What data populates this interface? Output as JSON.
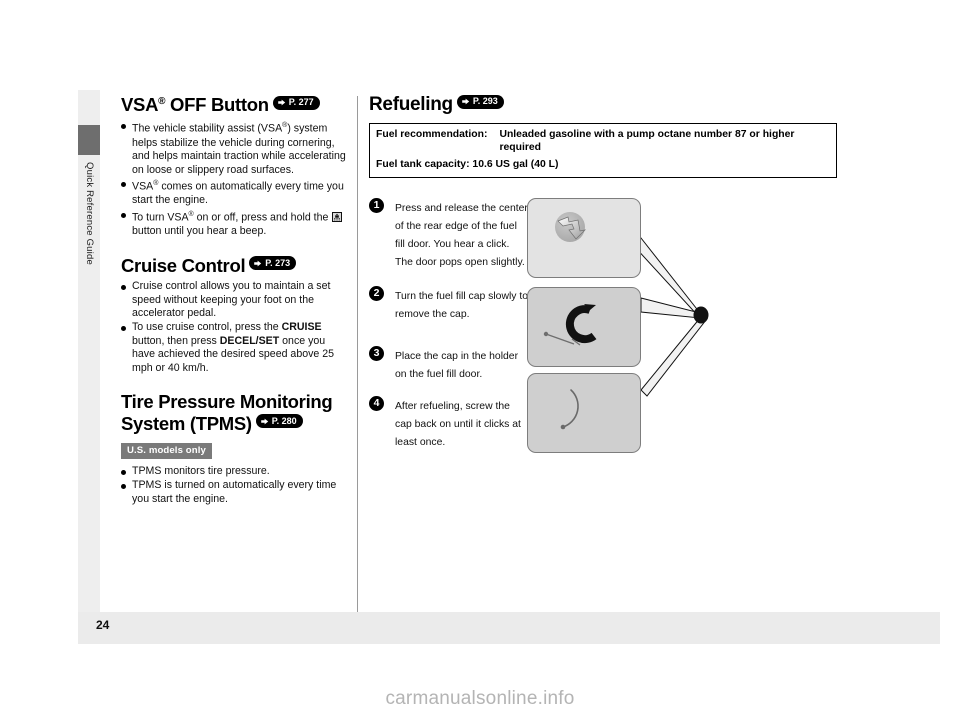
{
  "sidebar": {
    "tab_label": "Quick Reference Guide"
  },
  "left_column": {
    "vsa": {
      "title": "VSA",
      "title_sup": "®",
      "title_rest": " OFF Button",
      "page_ref": "P. 277",
      "bullets": [
        "The vehicle stability assist (VSA®) system helps stabilize the vehicle during cornering, and helps maintain traction while accelerating on loose or slippery road surfaces.",
        "VSA® comes on automatically every time you start the engine.",
        "To turn VSA® on or off, press and hold the [vsa-button-icon] button until you hear a beep."
      ]
    },
    "cruise": {
      "title": "Cruise Control",
      "page_ref": "P. 273",
      "bullets": [
        "Cruise control allows you to maintain a set speed without keeping your foot on the accelerator pedal.",
        "To use cruise control, press the CRUISE button, then press DECEL/SET once you have achieved the desired speed above 25 mph or 40 km/h."
      ],
      "bold_terms": [
        "CRUISE",
        "DECEL/SET"
      ]
    },
    "tpms": {
      "title_line1": "Tire Pressure Monitoring",
      "title_line2": "System (TPMS)",
      "page_ref": "P. 280",
      "badge": "U.S. models only",
      "bullets": [
        "TPMS monitors tire pressure.",
        "TPMS is turned on automatically every time you start the engine."
      ]
    }
  },
  "right_column": {
    "title": "Refueling",
    "page_ref": "P. 293",
    "fuel_table": {
      "rows": [
        {
          "label": "Fuel recommendation:",
          "value": "Unleaded gasoline with a pump octane number 87 or higher required"
        },
        {
          "label": "Fuel tank capacity: 10.6 US gal (40 L)",
          "value": ""
        }
      ]
    },
    "steps": [
      {
        "number": "1",
        "text": "Press and release the center of the rear edge of the fuel fill door. You hear a click. The door pops open slightly."
      },
      {
        "number": "2",
        "text": "Turn the fuel fill cap slowly to remove the cap."
      },
      {
        "number": "3",
        "text": "Place the cap in the holder on the fuel fill door."
      },
      {
        "number": "4",
        "text": "After refueling, screw the cap back on until it clicks at least once."
      }
    ],
    "illustrations": [
      {
        "name": "fuel-fill-door-press-illustration"
      },
      {
        "name": "fuel-cap-turn-illustration"
      },
      {
        "name": "fuel-cap-holder-illustration"
      }
    ]
  },
  "footer": {
    "page_number": "24",
    "watermark": "carmanualsonline.info"
  },
  "colors": {
    "tab_block": "#6e6e6e",
    "tab_strip": "#eeeeee",
    "badge_gray": "#7a7a7a",
    "footer_bar": "#ebebeb",
    "watermark": "#b4b4b4",
    "illustration_light": "#e3e3e3",
    "illustration_dark": "#cfcfcf"
  }
}
